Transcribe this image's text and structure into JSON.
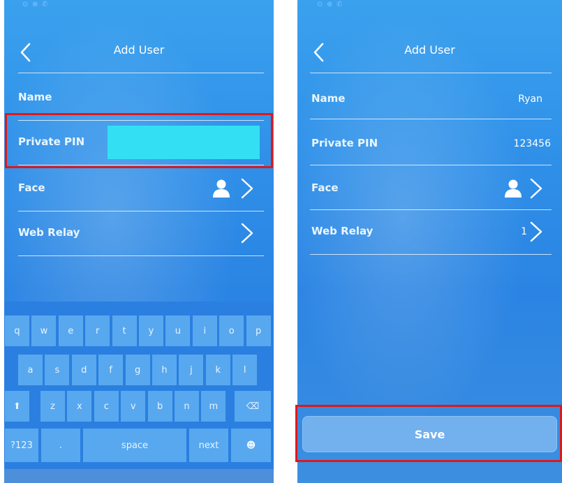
{
  "left_screen": {
    "title": "Add User",
    "fields": {
      "name_label": "Name",
      "pin_label": "Private PIN",
      "pin_value": "",
      "face_label": "Face",
      "web_relay_label": "Web Relay"
    },
    "keyboard": {
      "row1": [
        "q",
        "w",
        "e",
        "r",
        "t",
        "y",
        "u",
        "i",
        "o",
        "p"
      ],
      "row2": [
        "a",
        "s",
        "d",
        "f",
        "g",
        "h",
        "j",
        "k",
        "l"
      ],
      "row3": [
        "z",
        "x",
        "c",
        "v",
        "b",
        "n",
        "m"
      ],
      "shift_glyph": "⬆",
      "backspace_glyph": "⌫",
      "symbols_label": "?123",
      "period_label": ".",
      "space_label": "space",
      "next_label": "next",
      "emoji_glyph": "☻"
    }
  },
  "right_screen": {
    "title": "Add User",
    "fields": {
      "name_label": "Name",
      "name_value": "Ryan",
      "pin_label": "Private PIN",
      "pin_value": "123456",
      "face_label": "Face",
      "web_relay_label": "Web Relay",
      "web_relay_value": "1"
    },
    "save_label": "Save"
  },
  "colors": {
    "highlight": "#e01818",
    "pin_input_fill": "#33e0f3",
    "screen_background": "#2f8fe8"
  },
  "icons": [
    "back-chevron-icon",
    "person-icon",
    "chevron-right-icon",
    "shift-icon",
    "backspace-icon",
    "emoji-icon"
  ]
}
